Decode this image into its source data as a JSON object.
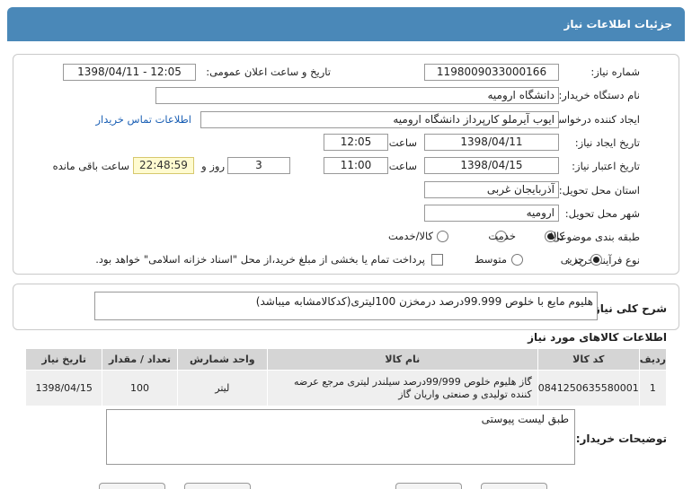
{
  "header": {
    "title": "جزئیات اطلاعات نیاز"
  },
  "info": {
    "need_number_label": "شماره نیاز:",
    "need_number": "1198009033000166",
    "announce_label": "تاریخ و ساعت اعلان عمومی:",
    "announce_value": "1398/04/11 - 12:05",
    "buyer_org_label": "نام دستگاه خریدار:",
    "buyer_org": "دانشگاه ارومیه",
    "requester_label": "ایجاد کننده درخواست:",
    "requester": "ایوب آیرملو کارپرداز دانشگاه ارومیه",
    "contact_link": "اطلاعات تماس خریدار",
    "created_label": "تاریخ ایجاد نیاز:",
    "created_date": "1398/04/11",
    "time_label": "ساعت",
    "created_time": "12:05",
    "valid_label": "تاریخ اعتبار نیاز:",
    "valid_date": "1398/04/15",
    "valid_time": "11:00",
    "days_label": "روز و",
    "days_value": "3",
    "remaining_value": "22:48:59",
    "remaining_label": "ساعت باقی مانده",
    "province_label": "استان محل تحویل:",
    "province": "آذربایجان غربی",
    "city_label": "شهر محل تحویل:",
    "city": "ارومیه",
    "category_label": "طبقه بندی موضوعی:",
    "category_options": [
      "کالا",
      "خدمت",
      "کالا/خدمت"
    ],
    "process_label": "نوع فرآیند خرید :",
    "process_options": [
      "جزیی",
      "متوسط"
    ],
    "payment_note": "پرداخت تمام یا بخشی از مبلغ خرید،از محل \"اسناد خزانه اسلامی\" خواهد بود."
  },
  "summary": {
    "label": "شرح کلی نیاز:",
    "text": "هلیوم مایع با خلوص 99.999درصد درمخزن 100لیتری(کدکالامشابه میباشد)"
  },
  "goods": {
    "title": "اطلاعات کالاهای مورد نیاز",
    "columns": [
      "ردیف",
      "کد کالا",
      "نام کالا",
      "واحد شمارش",
      "تعداد / مقدار",
      "تاریخ نیاز"
    ],
    "rows": [
      {
        "row": "1",
        "code": "0841250635580001",
        "name": "گاز هلیوم خلوص 99/999درصد سیلندر لیتری مرجع عرضه کننده تولیدی و صنعتی واریان گاز",
        "unit": "لیتر",
        "qty": "100",
        "date": "1398/04/15"
      }
    ]
  },
  "buyer_notes": {
    "label": "توضیحات خریدار:",
    "text": "طبق لیست پیوستی"
  }
}
